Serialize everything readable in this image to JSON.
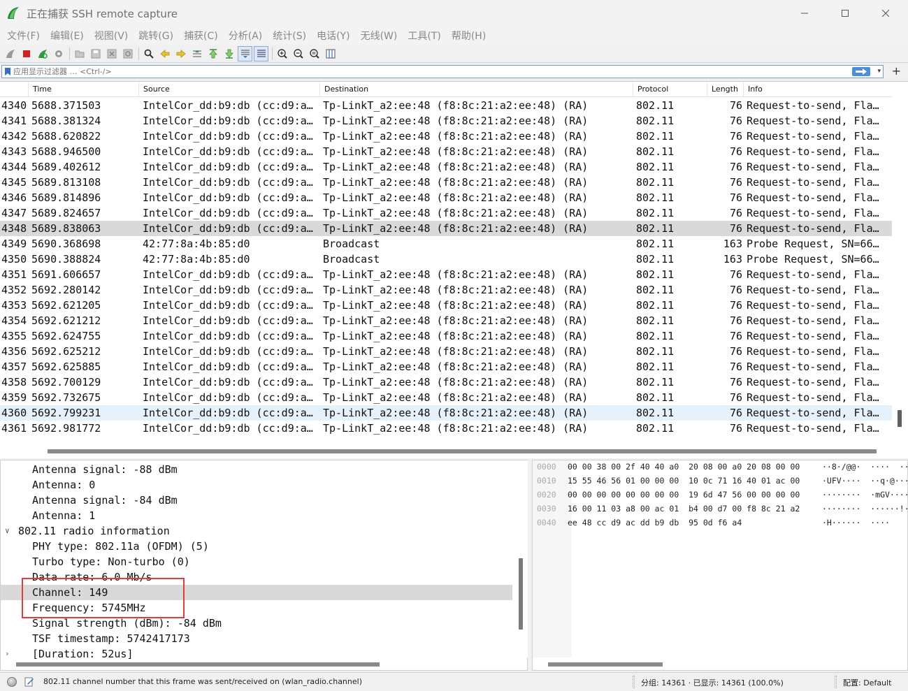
{
  "window": {
    "title": "正在捕获 SSH remote capture"
  },
  "menu": [
    "文件(F)",
    "编辑(E)",
    "视图(V)",
    "跳转(G)",
    "捕获(C)",
    "分析(A)",
    "统计(S)",
    "电话(Y)",
    "无线(W)",
    "工具(T)",
    "帮助(H)"
  ],
  "filter": {
    "placeholder": "应用显示过滤器 … <Ctrl-/>"
  },
  "columns": [
    "Time",
    "Source",
    "Destination",
    "Protocol",
    "Length",
    "Info"
  ],
  "packets": [
    {
      "no": "4340",
      "time": "5688.371503",
      "src": "IntelCor_dd:b9:db (cc:d9:a…",
      "dst": "Tp-LinkT_a2:ee:48 (f8:8c:21:a2:ee:48) (RA)",
      "proto": "802.11",
      "len": "76",
      "info": "Request-to-send, Fla…"
    },
    {
      "no": "4341",
      "time": "5688.381324",
      "src": "IntelCor_dd:b9:db (cc:d9:a…",
      "dst": "Tp-LinkT_a2:ee:48 (f8:8c:21:a2:ee:48) (RA)",
      "proto": "802.11",
      "len": "76",
      "info": "Request-to-send, Fla…"
    },
    {
      "no": "4342",
      "time": "5688.620822",
      "src": "IntelCor_dd:b9:db (cc:d9:a…",
      "dst": "Tp-LinkT_a2:ee:48 (f8:8c:21:a2:ee:48) (RA)",
      "proto": "802.11",
      "len": "76",
      "info": "Request-to-send, Fla…"
    },
    {
      "no": "4343",
      "time": "5688.946500",
      "src": "IntelCor_dd:b9:db (cc:d9:a…",
      "dst": "Tp-LinkT_a2:ee:48 (f8:8c:21:a2:ee:48) (RA)",
      "proto": "802.11",
      "len": "76",
      "info": "Request-to-send, Fla…"
    },
    {
      "no": "4344",
      "time": "5689.402612",
      "src": "IntelCor_dd:b9:db (cc:d9:a…",
      "dst": "Tp-LinkT_a2:ee:48 (f8:8c:21:a2:ee:48) (RA)",
      "proto": "802.11",
      "len": "76",
      "info": "Request-to-send, Fla…"
    },
    {
      "no": "4345",
      "time": "5689.813108",
      "src": "IntelCor_dd:b9:db (cc:d9:a…",
      "dst": "Tp-LinkT_a2:ee:48 (f8:8c:21:a2:ee:48) (RA)",
      "proto": "802.11",
      "len": "76",
      "info": "Request-to-send, Fla…"
    },
    {
      "no": "4346",
      "time": "5689.814896",
      "src": "IntelCor_dd:b9:db (cc:d9:a…",
      "dst": "Tp-LinkT_a2:ee:48 (f8:8c:21:a2:ee:48) (RA)",
      "proto": "802.11",
      "len": "76",
      "info": "Request-to-send, Fla…"
    },
    {
      "no": "4347",
      "time": "5689.824657",
      "src": "IntelCor_dd:b9:db (cc:d9:a…",
      "dst": "Tp-LinkT_a2:ee:48 (f8:8c:21:a2:ee:48) (RA)",
      "proto": "802.11",
      "len": "76",
      "info": "Request-to-send, Fla…"
    },
    {
      "no": "4348",
      "time": "5689.838063",
      "src": "IntelCor_dd:b9:db (cc:d9:a…",
      "dst": "Tp-LinkT_a2:ee:48 (f8:8c:21:a2:ee:48) (RA)",
      "proto": "802.11",
      "len": "76",
      "info": "Request-to-send, Fla…",
      "state": "selected"
    },
    {
      "no": "4349",
      "time": "5690.368698",
      "src": "42:77:8a:4b:85:d0",
      "dst": "Broadcast",
      "proto": "802.11",
      "len": "163",
      "info": "Probe Request, SN=66…"
    },
    {
      "no": "4350",
      "time": "5690.388824",
      "src": "42:77:8a:4b:85:d0",
      "dst": "Broadcast",
      "proto": "802.11",
      "len": "163",
      "info": "Probe Request, SN=66…"
    },
    {
      "no": "4351",
      "time": "5691.606657",
      "src": "IntelCor_dd:b9:db (cc:d9:a…",
      "dst": "Tp-LinkT_a2:ee:48 (f8:8c:21:a2:ee:48) (RA)",
      "proto": "802.11",
      "len": "76",
      "info": "Request-to-send, Fla…"
    },
    {
      "no": "4352",
      "time": "5692.280142",
      "src": "IntelCor_dd:b9:db (cc:d9:a…",
      "dst": "Tp-LinkT_a2:ee:48 (f8:8c:21:a2:ee:48) (RA)",
      "proto": "802.11",
      "len": "76",
      "info": "Request-to-send, Fla…"
    },
    {
      "no": "4353",
      "time": "5692.621205",
      "src": "IntelCor_dd:b9:db (cc:d9:a…",
      "dst": "Tp-LinkT_a2:ee:48 (f8:8c:21:a2:ee:48) (RA)",
      "proto": "802.11",
      "len": "76",
      "info": "Request-to-send, Fla…"
    },
    {
      "no": "4354",
      "time": "5692.621212",
      "src": "IntelCor_dd:b9:db (cc:d9:a…",
      "dst": "Tp-LinkT_a2:ee:48 (f8:8c:21:a2:ee:48) (RA)",
      "proto": "802.11",
      "len": "76",
      "info": "Request-to-send, Fla…"
    },
    {
      "no": "4355",
      "time": "5692.624755",
      "src": "IntelCor_dd:b9:db (cc:d9:a…",
      "dst": "Tp-LinkT_a2:ee:48 (f8:8c:21:a2:ee:48) (RA)",
      "proto": "802.11",
      "len": "76",
      "info": "Request-to-send, Fla…"
    },
    {
      "no": "4356",
      "time": "5692.625212",
      "src": "IntelCor_dd:b9:db (cc:d9:a…",
      "dst": "Tp-LinkT_a2:ee:48 (f8:8c:21:a2:ee:48) (RA)",
      "proto": "802.11",
      "len": "76",
      "info": "Request-to-send, Fla…"
    },
    {
      "no": "4357",
      "time": "5692.625885",
      "src": "IntelCor_dd:b9:db (cc:d9:a…",
      "dst": "Tp-LinkT_a2:ee:48 (f8:8c:21:a2:ee:48) (RA)",
      "proto": "802.11",
      "len": "76",
      "info": "Request-to-send, Fla…"
    },
    {
      "no": "4358",
      "time": "5692.700129",
      "src": "IntelCor_dd:b9:db (cc:d9:a…",
      "dst": "Tp-LinkT_a2:ee:48 (f8:8c:21:a2:ee:48) (RA)",
      "proto": "802.11",
      "len": "76",
      "info": "Request-to-send, Fla…"
    },
    {
      "no": "4359",
      "time": "5692.732675",
      "src": "IntelCor_dd:b9:db (cc:d9:a…",
      "dst": "Tp-LinkT_a2:ee:48 (f8:8c:21:a2:ee:48) (RA)",
      "proto": "802.11",
      "len": "76",
      "info": "Request-to-send, Fla…"
    },
    {
      "no": "4360",
      "time": "5692.799231",
      "src": "IntelCor_dd:b9:db (cc:d9:a…",
      "dst": "Tp-LinkT_a2:ee:48 (f8:8c:21:a2:ee:48) (RA)",
      "proto": "802.11",
      "len": "76",
      "info": "Request-to-send, Fla…",
      "state": "hover"
    },
    {
      "no": "4361",
      "time": "5692.981772",
      "src": "IntelCor_dd:b9:db (cc:d9:a…",
      "dst": "Tp-LinkT_a2:ee:48 (f8:8c:21:a2:ee:48) (RA)",
      "proto": "802.11",
      "len": "76",
      "info": "Request-to-send, Fla…"
    }
  ],
  "details": [
    {
      "text": "Antenna signal: -88 dBm",
      "level": 1
    },
    {
      "text": "Antenna: 0",
      "level": 1
    },
    {
      "text": "Antenna signal: -84 dBm",
      "level": 1
    },
    {
      "text": "Antenna: 1",
      "level": 1
    },
    {
      "text": "802.11 radio information",
      "level": 0,
      "expander": "∨"
    },
    {
      "text": "PHY type: 802.11a (OFDM) (5)",
      "level": 1
    },
    {
      "text": "Turbo type: Non-turbo (0)",
      "level": 1
    },
    {
      "text": "Data rate: 6.0 Mb/s",
      "level": 1
    },
    {
      "text": "Channel: 149",
      "level": 1,
      "selected": true
    },
    {
      "text": "Frequency: 5745MHz",
      "level": 1
    },
    {
      "text": "Signal strength (dBm): -84 dBm",
      "level": 1
    },
    {
      "text": "TSF timestamp: 5742417173",
      "level": 1
    },
    {
      "text": "[Duration: 52us]",
      "level": 1,
      "expander": "›"
    }
  ],
  "bytes": [
    {
      "off": "0000",
      "hex": "00 00 38 00 2f 40 40 a0  20 08 00 a0 20 08 00 00",
      "asc": "··8·/@@·  ····  ····"
    },
    {
      "off": "0010",
      "hex": "15 55 46 56 01 00 00 00  10 0c 71 16 40 01 ac 00",
      "asc": "·UFV····  ··q·@···"
    },
    {
      "off": "0020",
      "hex": "00 00 00 00 00 00 00 00  19 6d 47 56 00 00 00 00",
      "asc": "········  ·mGV····"
    },
    {
      "off": "0030",
      "hex": "16 00 11 03 a8 00 ac 01  b4 00 d7 00 f8 8c 21 a2",
      "asc": "········  ······!·"
    },
    {
      "off": "0040",
      "hex": "ee 48 cc d9 ac dd b9 db  95 0d f6 a4",
      "asc": "·H······  ····"
    }
  ],
  "status": {
    "field_desc": "802.11 channel number that this frame was sent/received on (wlan_radio.channel)",
    "packets": "分组: 14361 · 已显示: 14361 (100.0%)",
    "profile": "配置: Default"
  },
  "colors": {
    "selected_row": "#d9d9d9",
    "hover_row": "#e5f1fb",
    "highlight_box": "#e03c3c"
  }
}
